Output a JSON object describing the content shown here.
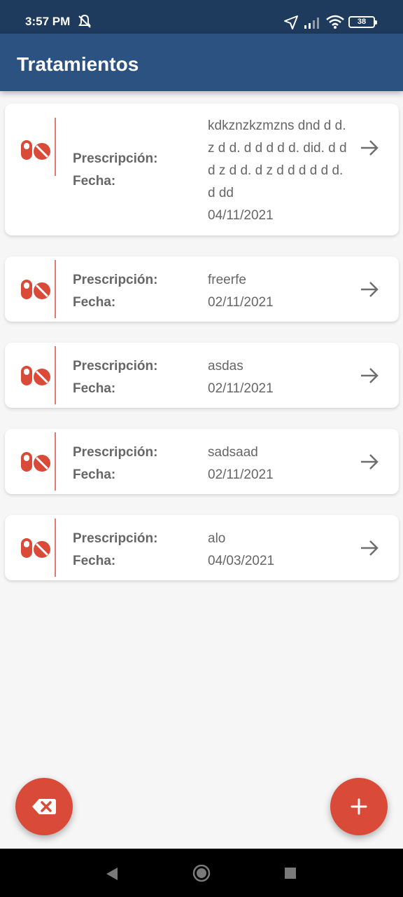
{
  "status_bar": {
    "time": "3:57 PM",
    "battery": "38"
  },
  "app_bar": {
    "title": "Tratamientos"
  },
  "labels": {
    "prescription": "Prescripción:",
    "date": "Fecha:"
  },
  "treatments": [
    {
      "prescription": "kdkznzkzmzns dnd d d. z d d. d d d d d. did. d d d z d d. d z d d d d d d. d dd",
      "date": "04/11/2021"
    },
    {
      "prescription": "freerfe",
      "date": "02/11/2021"
    },
    {
      "prescription": "asdas",
      "date": "02/11/2021"
    },
    {
      "prescription": "sadsaad",
      "date": "02/11/2021"
    },
    {
      "prescription": "alo",
      "date": "04/03/2021"
    }
  ],
  "icons": {
    "treatment": "pills-icon",
    "open": "arrow-right-icon",
    "delete": "backspace-icon",
    "add": "plus-icon"
  },
  "colors": {
    "accent": "#d94a38",
    "app_bar": "#2c5282",
    "status_bar": "#1e3a5c"
  }
}
